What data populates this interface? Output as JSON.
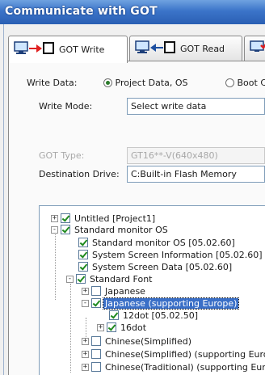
{
  "window": {
    "title": "Communicate with GOT"
  },
  "tabs": [
    {
      "label": "GOT Write",
      "icon": "pc-to-got-icon"
    },
    {
      "label": "GOT Read",
      "icon": "got-to-pc-icon"
    },
    {
      "label": "",
      "icon": "verify-icon"
    }
  ],
  "write_data": {
    "label": "Write Data:",
    "options": [
      {
        "label": "Project Data, OS",
        "selected": true
      },
      {
        "label": "Boot C",
        "selected": false
      }
    ]
  },
  "write_mode": {
    "label": "Write Mode:",
    "value": "Select write data"
  },
  "got_type": {
    "label": "GOT Type:",
    "value": "GT16**-V(640x480)",
    "disabled": true
  },
  "destination_drive": {
    "label": "Destination Drive:",
    "value": "C:Built-in Flash Memory"
  },
  "tree": [
    {
      "label": "Untitled [Project1]",
      "expander": "+",
      "checked": true
    },
    {
      "label": "Standard monitor OS",
      "expander": "-",
      "checked": true
    },
    {
      "label": "Standard monitor OS [05.02.60]",
      "checked": true
    },
    {
      "label": "System Screen Information [05.02.60]",
      "checked": true
    },
    {
      "label": "System Screen Data [05.02.60]",
      "checked": true
    },
    {
      "label": "Standard Font",
      "expander": "-",
      "checked": true
    },
    {
      "label": "Japanese",
      "expander": "+",
      "checked": false
    },
    {
      "label": "Japanese (supporting Europe)",
      "expander": "-",
      "checked": true,
      "selected": true
    },
    {
      "label": "12dot [05.02.50]",
      "checked": true
    },
    {
      "label": "16dot",
      "expander": "+",
      "checked": true
    },
    {
      "label": "Chinese(Simplified)",
      "expander": "+",
      "checked": false
    },
    {
      "label": "Chinese(Simplified) (supporting Europe",
      "expander": "+",
      "checked": false
    },
    {
      "label": "Chinese(Traditional) (supporting Europe",
      "expander": "+",
      "checked": false
    }
  ],
  "colors": {
    "title_bar": "#3b74c9",
    "selection": "#3a6fc7",
    "check": "#1f8a1f",
    "arrow": "#e02020"
  }
}
